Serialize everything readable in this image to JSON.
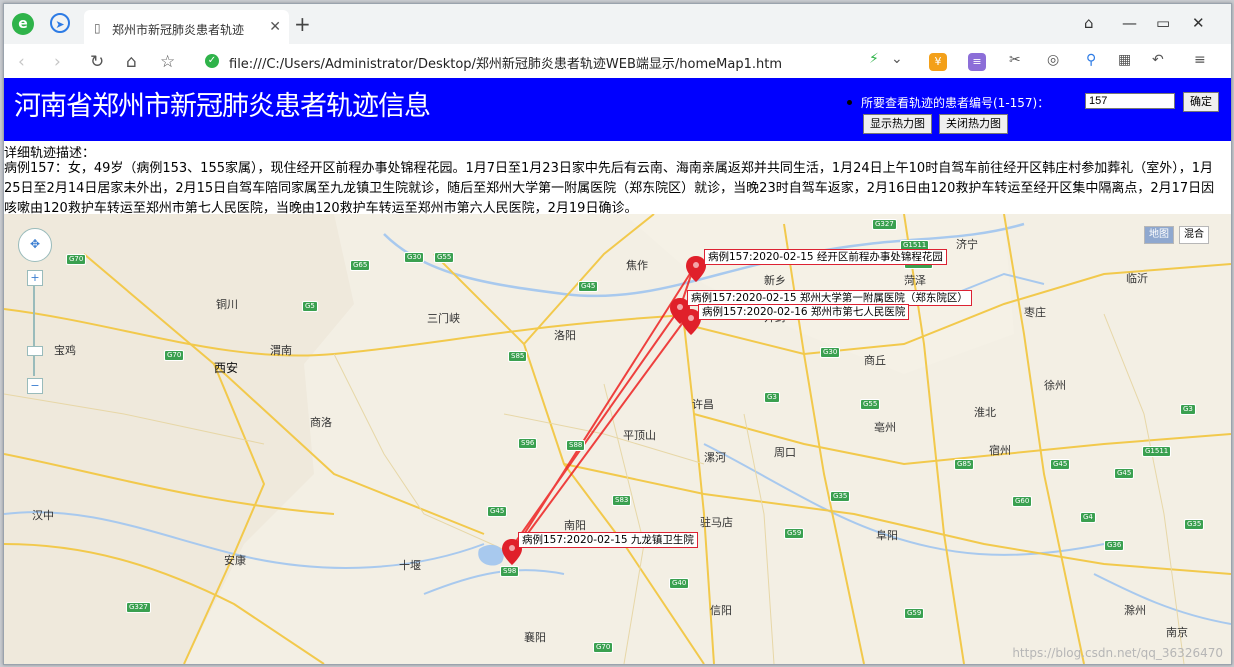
{
  "browser": {
    "tab_title": "郑州市新冠肺炎患者轨迹",
    "url": "file:///C:/Users/Administrator/Desktop/郑州新冠肺炎患者轨迹WEB端显示/homeMap1.htm"
  },
  "page": {
    "title": "河南省郑州市新冠肺炎患者轨迹信息",
    "form_label": "所要查看轨迹的患者编号(1-157)：",
    "patient_input": "157",
    "confirm_button": "确定",
    "show_heatmap_button": "显示热力图",
    "close_heatmap_button": "关闭热力图",
    "desc_title": "详细轨迹描述：",
    "description": "病例157：女，49岁（病例153、155家属），现住经开区前程办事处锦程花园。1月7日至1月23日家中先后有云南、海南亲属返郑并共同生活，1月24日上午10时自驾车前往经开区韩庄村参加葬礼（室外），1月25日至2月14日居家未外出，2月15日自驾车陪同家属至九龙镇卫生院就诊，随后至郑州大学第一附属医院（郑东院区）就诊，当晚23时自驾车返家，2月16日由120救护车转运至经开区集中隔离点，2月17日因咳嗽由120救护车转运至郑州市第七人民医院，当晚由120救护车转运至郑州市第六人民医院，2月19日确诊。"
  },
  "map": {
    "map_type_map": "地图",
    "map_type_hybrid": "混合",
    "markers": [
      {
        "label": "病例157:2020-02-15 经开区前程办事处锦程花园"
      },
      {
        "label": "病例157:2020-02-15 郑州大学第一附属医院（郑东院区）"
      },
      {
        "label": "病例157:2020-02-16 郑州市第七人民医院"
      },
      {
        "label": "病例157:2020-02-15 九龙镇卫生院"
      }
    ],
    "cities": [
      "西安",
      "渭南",
      "商洛",
      "安康",
      "汉中",
      "洛阳",
      "三门峡",
      "平顶山",
      "许昌",
      "漯河",
      "周口",
      "驻马店",
      "南阳",
      "十堰",
      "襄阳",
      "信阳",
      "商丘",
      "亳州",
      "阜阳",
      "淮北",
      "宿州",
      "徐州",
      "菏泽",
      "济宁",
      "临沂",
      "枣庄",
      "南京",
      "滁州",
      "焦作",
      "新乡",
      "开封",
      "铜川",
      "宝鸡"
    ],
    "city_labels": {
      "xian": "西安",
      "zhengzhou": "郑州"
    },
    "roads": [
      "G70",
      "G5",
      "G30",
      "G65",
      "G55",
      "G85",
      "G36",
      "G40",
      "G4",
      "G3",
      "G35",
      "G45",
      "G59",
      "G15",
      "S85",
      "S88",
      "S96",
      "S83",
      "G50",
      "G60",
      "G65",
      "G1511",
      "G327",
      "S98"
    ],
    "watermark": "https://blog.csdn.net/qq_36326470"
  }
}
